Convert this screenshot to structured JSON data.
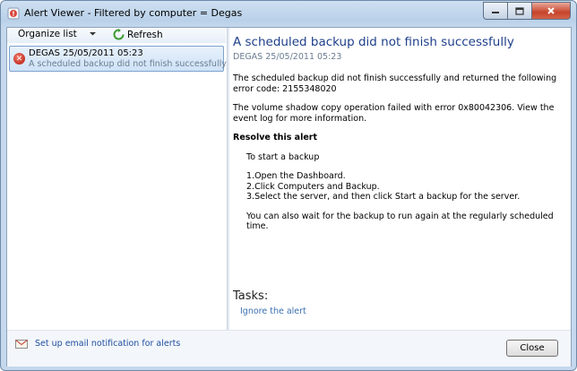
{
  "window": {
    "title": "Alert Viewer - Filtered by computer = Degas"
  },
  "toolbar": {
    "organize_label": "Organize list",
    "refresh_label": "Refresh"
  },
  "alerts": [
    {
      "title": "DEGAS 25/05/2011 05:23",
      "subtitle": "A scheduled backup did not finish successfully",
      "icon": "error-icon"
    }
  ],
  "detail": {
    "title": "A scheduled backup did not finish successfully",
    "date": "DEGAS 25/05/2011 05:23",
    "para1": "The scheduled backup did not finish successfully and returned the following error code: 2155348020",
    "para2": "The volume shadow copy operation failed with error 0x80042306. View the event log for more information.",
    "resolve_heading": "Resolve this alert",
    "start_intro": "To start a backup",
    "steps": [
      "1.Open the Dashboard.",
      "2.Click Computers and Backup.",
      "3.Select the server, and then click Start a backup for the server."
    ],
    "wait_text": "You can also wait for the backup to run again at the regularly scheduled time."
  },
  "tasks": {
    "label": "Tasks:",
    "ignore_link": "Ignore the alert"
  },
  "footer": {
    "email_link": "Set up email notification for alerts",
    "close_label": "Close"
  },
  "colors": {
    "title_blue": "#1e3f8a",
    "link_blue": "#3a6fb0",
    "error_red": "#b3150a"
  }
}
